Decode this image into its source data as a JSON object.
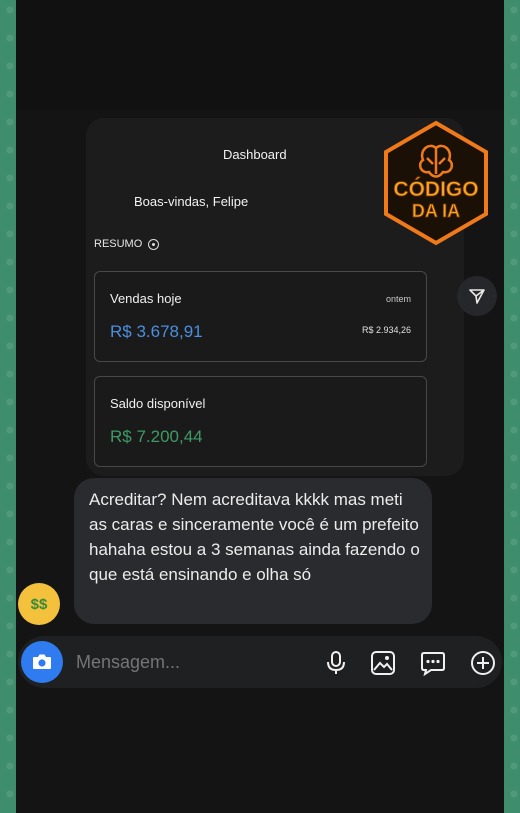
{
  "dashboard": {
    "title": "Dashboard",
    "welcome": "Boas-vindas, Felipe",
    "section_label": "RESUMO",
    "sales": {
      "label": "Vendas hoje",
      "value": "R$ 3.678,91",
      "compare_label": "ontem",
      "compare_value": "R$ 2.934,26"
    },
    "balance": {
      "label": "Saldo disponível",
      "value": "R$ 7.200,44"
    }
  },
  "logo": {
    "line1": "CÓDIGO",
    "line2": "DA IA"
  },
  "message": {
    "text": "Acreditar? Nem acreditava kkkk mas meti as caras e sinceramente você é um prefeito hahaha estou a 3 semanas ainda fazendo o que está ensinando e olha só",
    "reaction_emoji": "money-mouth-face"
  },
  "composer": {
    "placeholder": "Mensagem..."
  },
  "colors": {
    "accent_blue": "#2f7cf0",
    "value_blue": "#4a8fe0",
    "value_green": "#3f9a64",
    "logo_orange": "#f07a1a"
  }
}
